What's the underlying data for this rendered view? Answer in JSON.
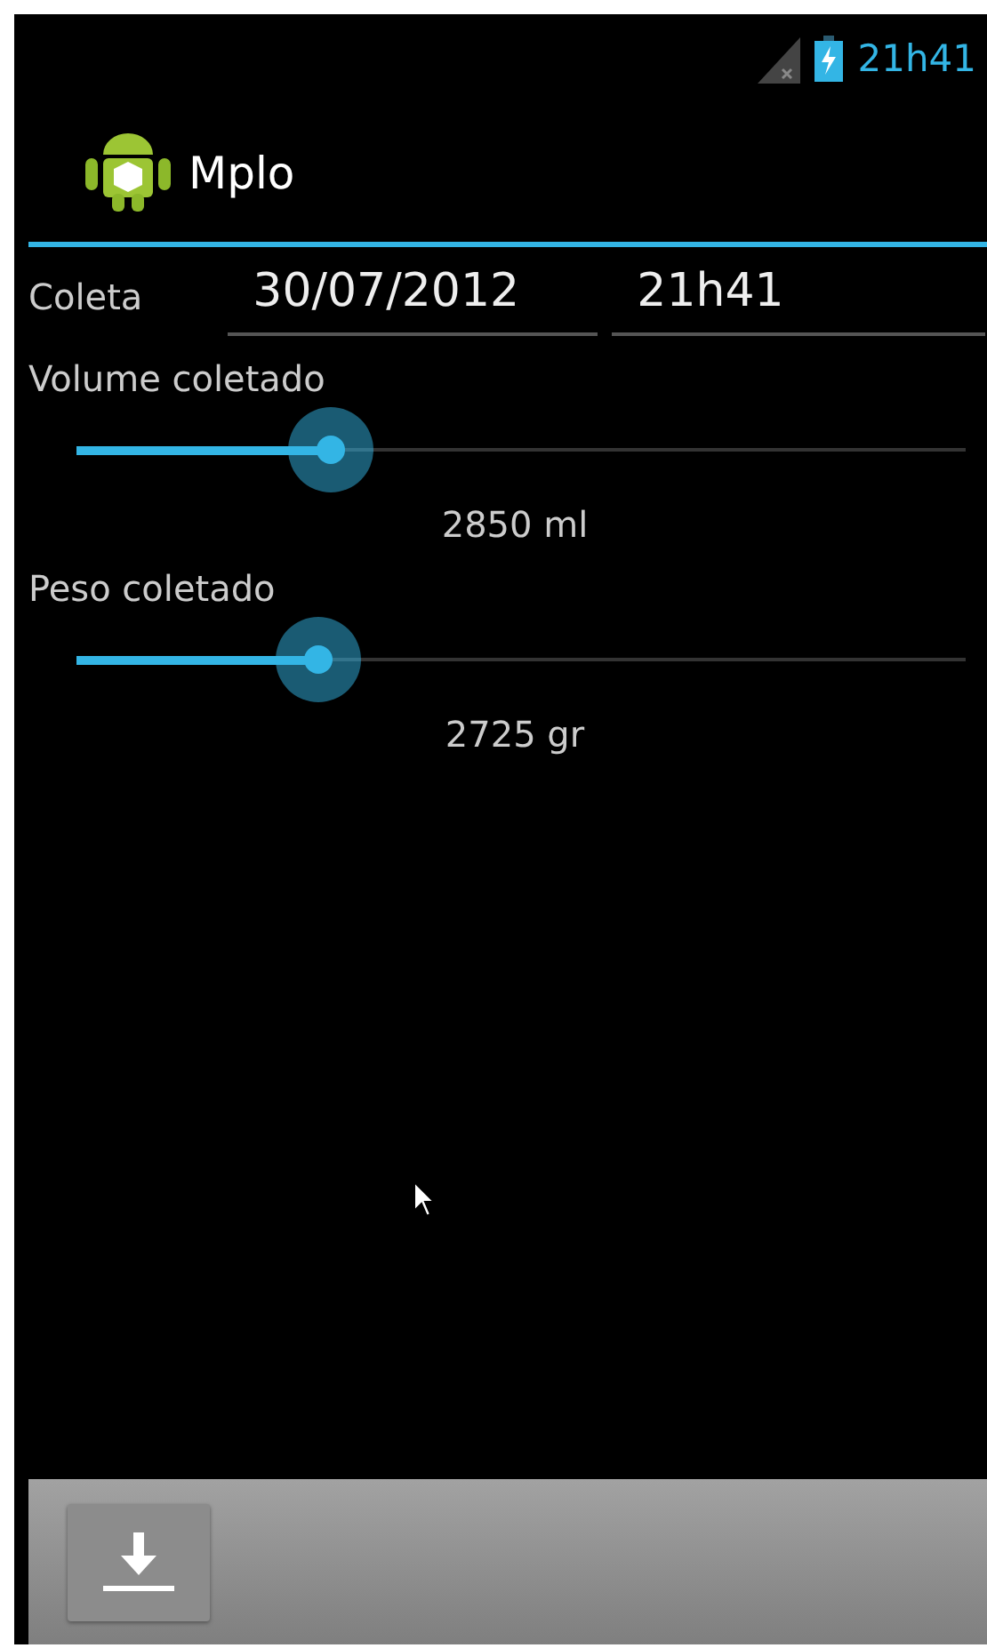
{
  "status_bar": {
    "time": "21h41"
  },
  "action_bar": {
    "title": "Mplo"
  },
  "collection": {
    "label": "Coleta",
    "date": "30/07/2012",
    "time": "21h41"
  },
  "sliders": [
    {
      "label": "Volume coletado",
      "level": 0.285,
      "reading": "2850 ml"
    },
    {
      "label": "Peso coletado",
      "level": 0.272,
      "reading": "2725 gr"
    }
  ]
}
